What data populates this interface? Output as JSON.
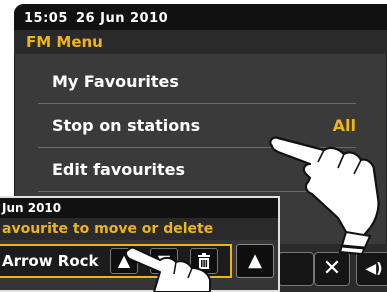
{
  "status": {
    "time": "15:05",
    "date": "26 Jun 2010"
  },
  "menu": {
    "title": "FM Menu",
    "items": [
      {
        "label": "My Favourites",
        "value": ""
      },
      {
        "label": "Stop on stations",
        "value": "All"
      },
      {
        "label": "Edit favourites",
        "value": ""
      }
    ]
  },
  "popup": {
    "status_date": "Jun 2010",
    "title": "avourite to move or delete",
    "station": "Arrow Rock",
    "up_icon": "▲",
    "down_icon": "▼",
    "side_icon": "▲"
  },
  "bottom": {
    "close_icon": "✕",
    "vol_icon": "◀)"
  },
  "colors": {
    "accent": "#f0b418",
    "background": "#3a3a3a"
  }
}
